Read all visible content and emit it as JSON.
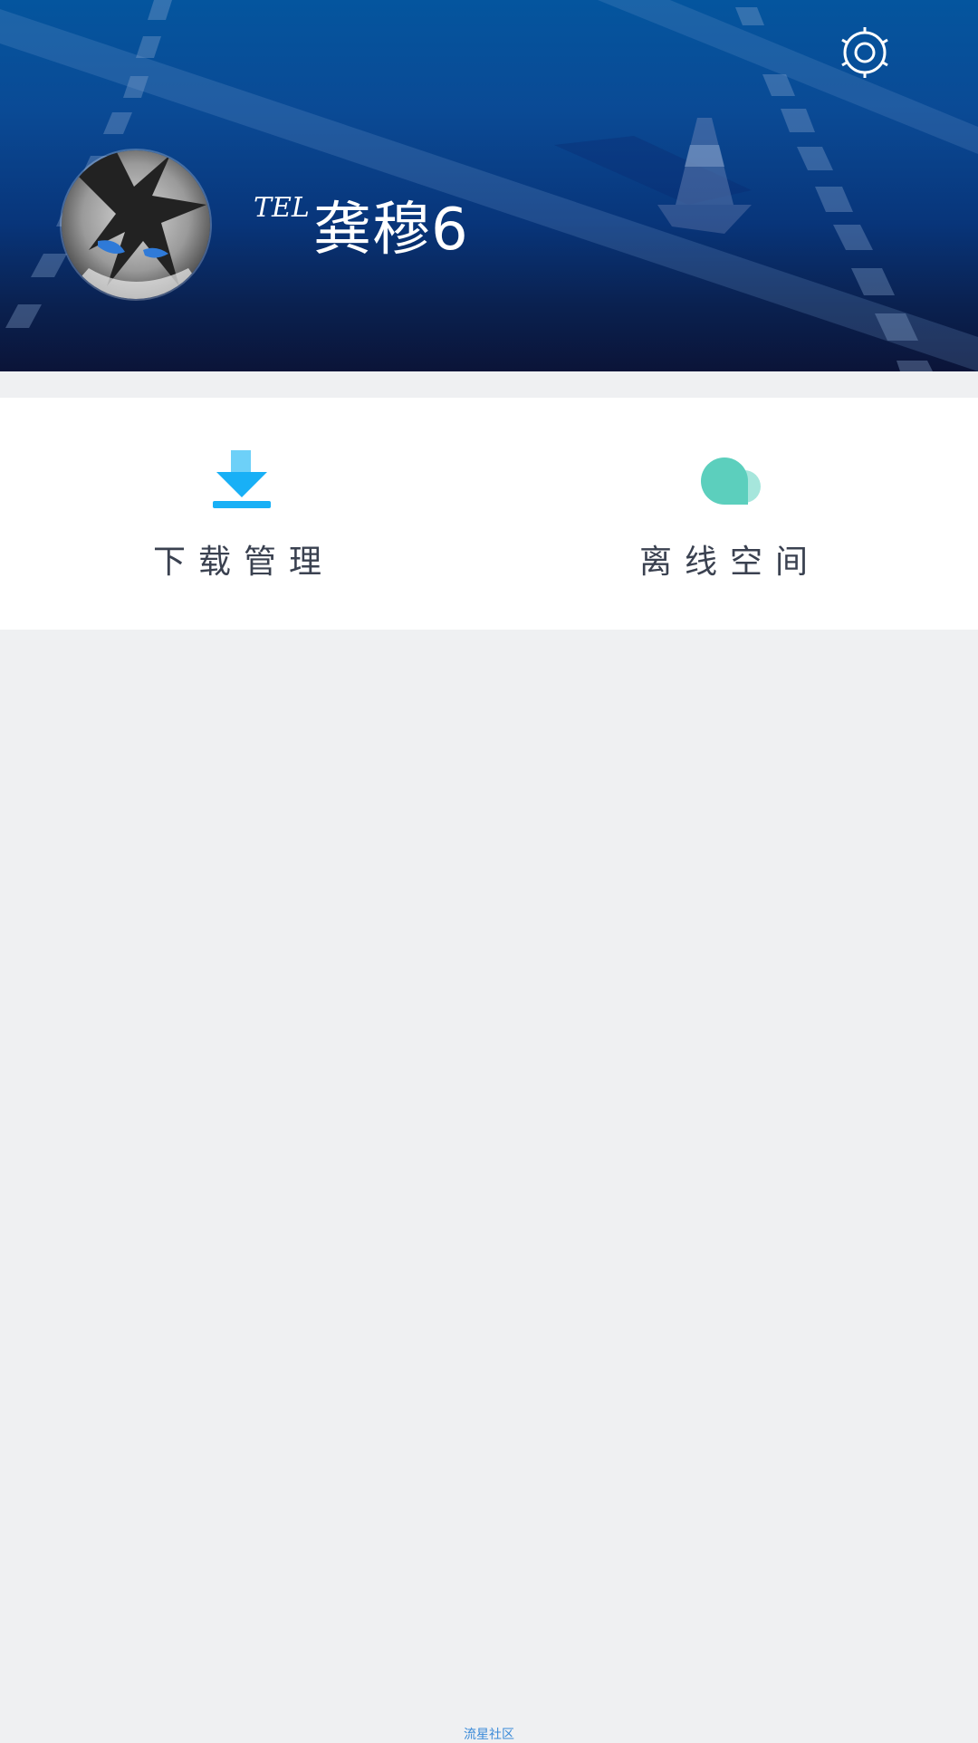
{
  "header": {
    "settings_icon": "gear-icon",
    "tel_label": "TEL",
    "user_name": "龚穆6",
    "background_colors": [
      "#04559e",
      "#0b1438"
    ]
  },
  "actions": [
    {
      "label": "下载管理",
      "icon": "download-icon",
      "color": "#18b0f6"
    },
    {
      "label": "离线空间",
      "icon": "cloud-icon",
      "color": "#5ccfbd"
    }
  ],
  "footer": {
    "link": "流星社区"
  }
}
